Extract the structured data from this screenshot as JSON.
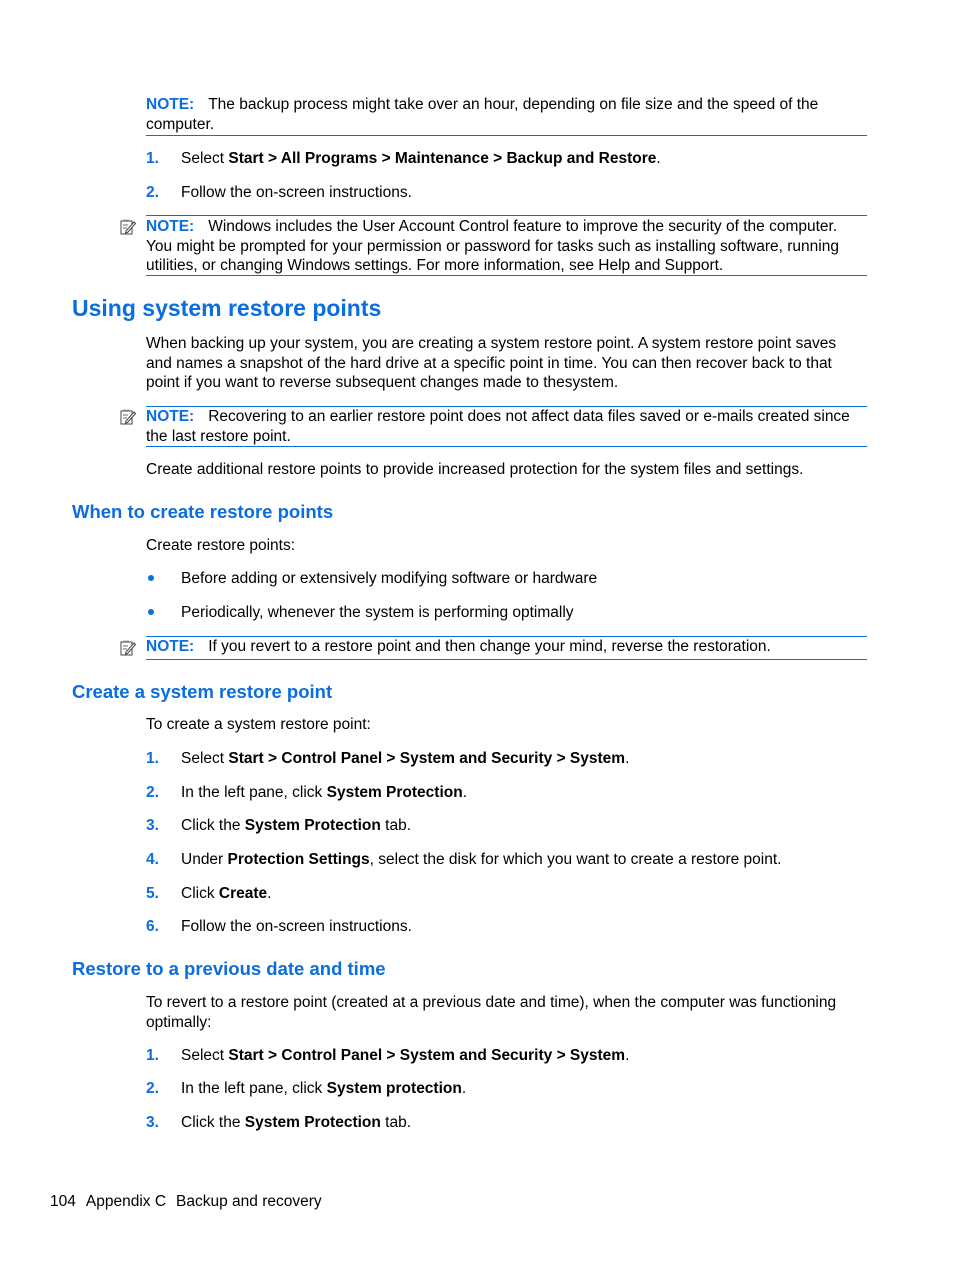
{
  "colors": {
    "accent": "#0a6de0",
    "text": "#000000"
  },
  "note_label": "NOTE:",
  "notes": [
    {
      "text": "The backup process might take over an hour, depending on file size and the speed of the computer.",
      "icon": "note-pencil-icon",
      "has_icon": false
    },
    {
      "text": "Windows includes the User Account Control feature to improve the security of the computer. You might be prompted for your permission or password for tasks such as installing software, running utilities, or changing Windows settings. For more information, see Help and Support.",
      "icon": "note-pencil-icon",
      "has_icon": true
    },
    {
      "text": "Recovering to an earlier restore point does not affect data files saved or e-mails created since the last restore point.",
      "icon": "note-pencil-icon",
      "has_icon": true
    },
    {
      "text": "If you revert to a restore point and then change your mind, reverse the restoration.",
      "icon": "note-pencil-icon",
      "has_icon": true
    }
  ],
  "intro_steps": [
    {
      "num": "1.",
      "pre": "Select ",
      "bold": "Start > All Programs > Maintenance > Backup and Restore",
      "post": "."
    },
    {
      "num": "2.",
      "pre": "Follow the on-screen instructions.",
      "bold": "",
      "post": ""
    }
  ],
  "section_using": {
    "title": "Using system restore points",
    "para1_lines": [
      "When backing up your system, you are creating a system restore point. A system restore point saves",
      "and names a snapshot of the hard drive at a specific point in time. You can then recover back to that",
      "point if you want to reverse subsequent changes made to thesystem."
    ],
    "para2": "Create additional restore points to provide increased protection for the system files and settings."
  },
  "section_when": {
    "title": "When to create restore points",
    "intro": "Create restore points:",
    "bullets": [
      "Before adding or extensively modifying software or hardware",
      "Periodically, whenever the system is performing optimally"
    ]
  },
  "section_create": {
    "title": "Create a system restore point",
    "intro": "To create a system restore point:",
    "steps": [
      {
        "num": "1.",
        "pre": "Select ",
        "bold": "Start > Control Panel > System and Security > System",
        "post": "."
      },
      {
        "num": "2.",
        "pre": "In the left pane, click ",
        "bold": "System Protection",
        "post": "."
      },
      {
        "num": "3.",
        "pre": "Click the ",
        "bold": "System Protection",
        "post": " tab."
      },
      {
        "num": "4.",
        "pre": "Under ",
        "bold": "Protection Settings",
        "post": ", select the disk for which you want to create a restore point."
      },
      {
        "num": "5.",
        "pre": "Click ",
        "bold": "Create",
        "post": "."
      },
      {
        "num": "6.",
        "pre": "Follow the on-screen instructions.",
        "bold": "",
        "post": ""
      }
    ]
  },
  "section_restore": {
    "title": "Restore to a previous date and time",
    "intro_lines": [
      "To revert to a restore point (created at a previous date and time), when the computer was functioning",
      "optimally:"
    ],
    "steps": [
      {
        "num": "1.",
        "pre": "Select ",
        "bold": "Start > Control Panel > System and Security > System",
        "post": "."
      },
      {
        "num": "2.",
        "pre": "In the left pane, click ",
        "bold": "System protection",
        "post": "."
      },
      {
        "num": "3.",
        "pre": "Click the ",
        "bold": "System Protection",
        "post": " tab."
      }
    ]
  },
  "footer": {
    "page_number": "104",
    "appendix": "Appendix C",
    "chapter": "Backup and recovery"
  }
}
